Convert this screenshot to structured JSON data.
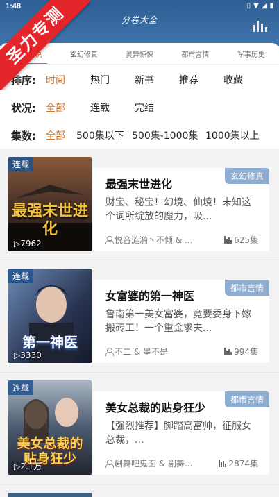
{
  "status": {
    "time": "1:48"
  },
  "app_title": "分卷大全",
  "ribbon": "圣力专测",
  "tabs": [
    {
      "label": "全部小说",
      "active": true
    },
    {
      "label": "玄幻修真",
      "active": false
    },
    {
      "label": "灵异惊悚",
      "active": false
    },
    {
      "label": "都市言情",
      "active": false
    },
    {
      "label": "军事历史",
      "active": false
    }
  ],
  "filters": {
    "sort": {
      "label": "排序:",
      "options": [
        "时间",
        "热门",
        "新书",
        "推荐",
        "收藏"
      ]
    },
    "status": {
      "label": "状况:",
      "options": [
        "全部",
        "连载",
        "完结"
      ]
    },
    "episodes": {
      "label": "集数:",
      "options": [
        "全部",
        "500集以下",
        "500集-1000集",
        "1000集以上"
      ]
    }
  },
  "books": [
    {
      "serial": "连载",
      "plays": "7962",
      "title": "最强末世进化",
      "genre": "玄幻修真",
      "desc": "财宝、秘宝！幻境、仙境！未知这个词所绽放的魔力，吸...",
      "authors": "悦音涟漪丶不倾 & ...",
      "episodes": "625集",
      "cover_text": "最强末世进化"
    },
    {
      "serial": "连载",
      "plays": "3330",
      "title": "女富婆的第一神医",
      "genre": "都市言情",
      "desc": "鲁南第一美女富婆，竟要委身下嫁搬砖工！一个重金求夫...",
      "authors": "不二 & 墨不是",
      "episodes": "994集",
      "cover_text": "第一神医"
    },
    {
      "serial": "连载",
      "plays": "2.1万",
      "title": "美女总裁的贴身狂少",
      "genre": "都市言情",
      "desc": "【强烈推荐】脚踏高富帅，征服女总裁，...",
      "authors": "剧舞吧鬼面 & 剧舞...",
      "episodes": "2874集",
      "cover_text": "美女总裁的贴身狂少"
    }
  ],
  "colors": {
    "accent": "#d3711a",
    "header": "#2f5f94",
    "ribbon": "#e4262b"
  }
}
